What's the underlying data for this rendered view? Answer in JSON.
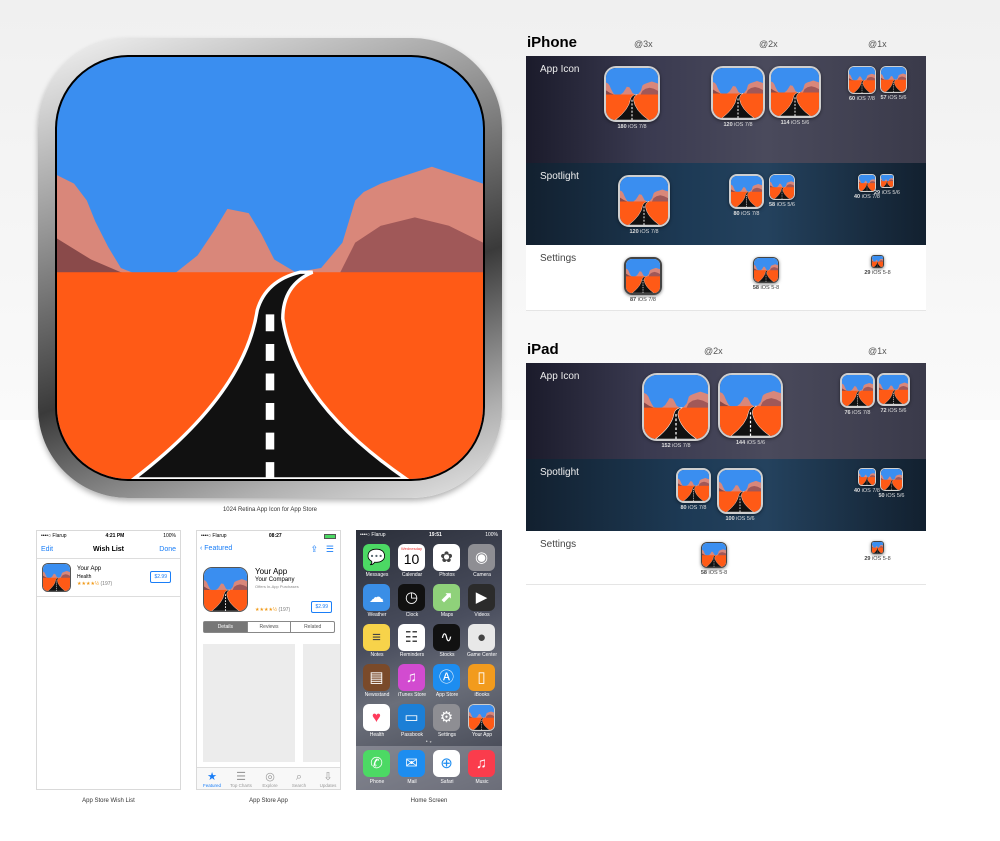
{
  "main_icon": {
    "caption": "1024 Retina App Icon for App Store"
  },
  "iphone": {
    "title": "iPhone",
    "columns": [
      "@3x",
      "@2x",
      "@1x"
    ],
    "rows": [
      {
        "label": "App Icon",
        "icons": [
          {
            "size": "180",
            "ver": "iOS 7/8"
          },
          {
            "size": "120",
            "ver": "iOS 7/8"
          },
          {
            "size": "114",
            "ver": "iOS 5/6"
          },
          {
            "size": "60",
            "ver": "iOS 7/8"
          },
          {
            "size": "57",
            "ver": "iOS 5/6"
          }
        ]
      },
      {
        "label": "Spotlight",
        "icons": [
          {
            "size": "120",
            "ver": "iOS 7/8"
          },
          {
            "size": "80",
            "ver": "iOS 7/8"
          },
          {
            "size": "58",
            "ver": "iOS 5/6"
          },
          {
            "size": "40",
            "ver": "iOS 7/8"
          },
          {
            "size": "29",
            "ver": "iOS 5/6"
          }
        ]
      },
      {
        "label": "Settings",
        "icons": [
          {
            "size": "87",
            "ver": "iOS 7/8"
          },
          {
            "size": "58",
            "ver": "iOS 5-8"
          },
          {
            "size": "29",
            "ver": "iOS 5-8"
          }
        ]
      }
    ]
  },
  "ipad": {
    "title": "iPad",
    "columns": [
      "@2x",
      "@1x"
    ],
    "rows": [
      {
        "label": "App Icon",
        "icons": [
          {
            "size": "152",
            "ver": "iOS 7/8"
          },
          {
            "size": "144",
            "ver": "iOS 5/6"
          },
          {
            "size": "76",
            "ver": "iOS 7/8"
          },
          {
            "size": "72",
            "ver": "iOS 5/6"
          }
        ]
      },
      {
        "label": "Spotlight",
        "icons": [
          {
            "size": "80",
            "ver": "iOS 7/8"
          },
          {
            "size": "100",
            "ver": "iOS 5/6"
          },
          {
            "size": "40",
            "ver": "iOS 7/8"
          },
          {
            "size": "50",
            "ver": "iOS 5/6"
          }
        ]
      },
      {
        "label": "Settings",
        "icons": [
          {
            "size": "58",
            "ver": "iOS 5-8"
          },
          {
            "size": "29",
            "ver": "iOS 5-8"
          }
        ]
      }
    ]
  },
  "wishlist": {
    "caption": "App Store Wish List",
    "status": {
      "carrier": "••••○ Flarup",
      "time": "4:21 PM",
      "battery": "100%"
    },
    "nav": {
      "left": "Edit",
      "title": "Wish List",
      "right": "Done"
    },
    "item": {
      "name": "Your App",
      "category": "Health",
      "stars": "★★★★½",
      "count": "(197)",
      "price": "$2.99"
    }
  },
  "appstore": {
    "caption": "App Store App",
    "status": {
      "carrier": "••••○ Flarup",
      "time": "08:27"
    },
    "nav": {
      "back": "Featured"
    },
    "app": {
      "name": "Your App",
      "company": "Your Company",
      "iap": "Offers In-App Purchases",
      "stars": "★★★★½",
      "count": "(197)",
      "price": "$2.99"
    },
    "segments": [
      "Details",
      "Reviews",
      "Related"
    ],
    "tabs": [
      {
        "label": "Featured",
        "icon": "star-icon",
        "glyph": "★"
      },
      {
        "label": "Top Charts",
        "icon": "list-icon",
        "glyph": "☰"
      },
      {
        "label": "Explore",
        "icon": "compass-icon",
        "glyph": "◎"
      },
      {
        "label": "Search",
        "icon": "search-icon",
        "glyph": "⌕"
      },
      {
        "label": "Updates",
        "icon": "download-icon",
        "glyph": "⇩"
      }
    ]
  },
  "home": {
    "caption": "Home Screen",
    "status": {
      "carrier": "••••○ Flarup",
      "time": "19:51",
      "battery": "100%"
    },
    "calendar": {
      "day": "Wednesday",
      "date": "10"
    },
    "apps": [
      {
        "label": "Messages",
        "color": "#4cd964",
        "glyph": "💬"
      },
      {
        "label": "Calendar",
        "color": "#ffffff",
        "glyph": ""
      },
      {
        "label": "Photos",
        "color": "#ffffff",
        "glyph": "✿"
      },
      {
        "label": "Camera",
        "color": "#8e8e93",
        "glyph": "◉"
      },
      {
        "label": "Weather",
        "color": "#3a8ee6",
        "glyph": "☁"
      },
      {
        "label": "Clock",
        "color": "#111111",
        "glyph": "◷"
      },
      {
        "label": "Maps",
        "color": "#8fd17a",
        "glyph": "⬈"
      },
      {
        "label": "Videos",
        "color": "#2b2b2b",
        "glyph": "▶"
      },
      {
        "label": "Notes",
        "color": "#f7d34a",
        "glyph": "≡"
      },
      {
        "label": "Reminders",
        "color": "#ffffff",
        "glyph": "☷"
      },
      {
        "label": "Stocks",
        "color": "#111111",
        "glyph": "∿"
      },
      {
        "label": "Game Center",
        "color": "#e8e8e8",
        "glyph": "●"
      },
      {
        "label": "Newsstand",
        "color": "#7a4a2a",
        "glyph": "▤"
      },
      {
        "label": "iTunes Store",
        "color": "#d24bd0",
        "glyph": "♫"
      },
      {
        "label": "App Store",
        "color": "#1d8df0",
        "glyph": "Ⓐ"
      },
      {
        "label": "iBooks",
        "color": "#f29b1d",
        "glyph": "▯"
      },
      {
        "label": "Health",
        "color": "#ffffff",
        "glyph": "♥"
      },
      {
        "label": "Passbook",
        "color": "#1c7fd6",
        "glyph": "▭"
      },
      {
        "label": "Settings",
        "color": "#8e8e93",
        "glyph": "⚙"
      },
      {
        "label": "Your App",
        "color": "app",
        "glyph": ""
      }
    ],
    "dock": [
      {
        "label": "Phone",
        "color": "#4cd964",
        "glyph": "✆"
      },
      {
        "label": "Mail",
        "color": "#1d8df0",
        "glyph": "✉"
      },
      {
        "label": "Safari",
        "color": "#ffffff",
        "glyph": "⊕"
      },
      {
        "label": "Music",
        "color": "#fa3c4c",
        "glyph": "♫"
      }
    ]
  }
}
